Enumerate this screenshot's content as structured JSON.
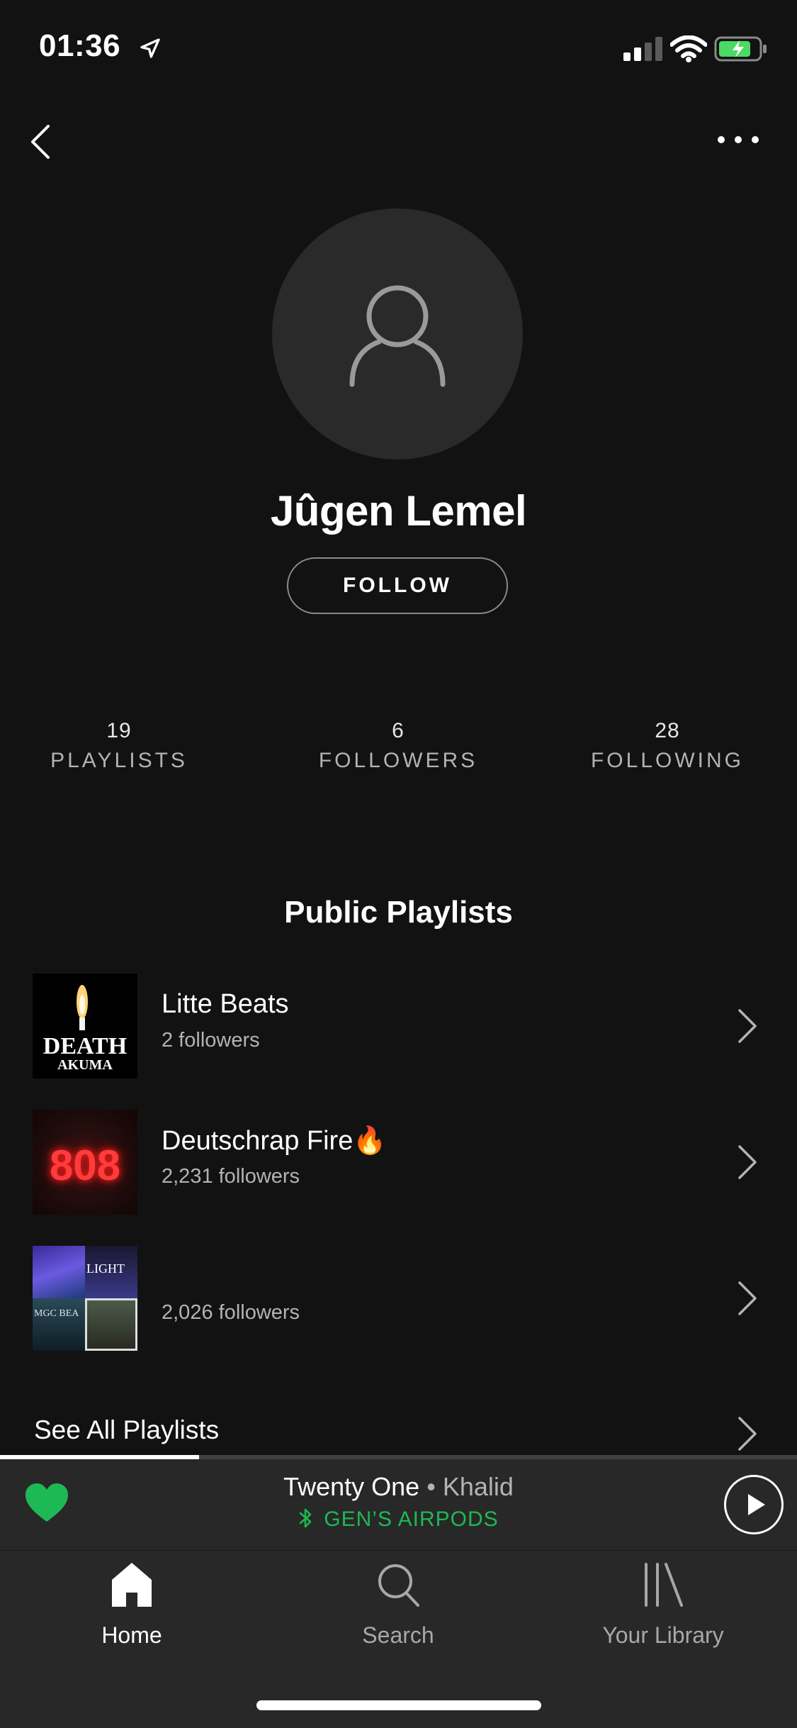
{
  "status_bar": {
    "time": "01:36"
  },
  "profile": {
    "name": "Jûgen Lemel",
    "follow_label": "FOLLOW"
  },
  "stats": [
    {
      "value": "19",
      "label": "PLAYLISTS"
    },
    {
      "value": "6",
      "label": "FOLLOWERS"
    },
    {
      "value": "28",
      "label": "FOLLOWING"
    }
  ],
  "section": {
    "title": "Public Playlists",
    "see_all_label": "See All Playlists"
  },
  "playlists": [
    {
      "title": "Litte Beats",
      "followers": "2 followers",
      "art_text_1": "DEATH",
      "art_text_2": "AKUMA"
    },
    {
      "title": "Deutschrap Fire🔥",
      "followers": "2,231 followers",
      "art_text_1": "808"
    },
    {
      "title": "",
      "followers": "2,026 followers",
      "art_text_1": "LIGHT",
      "art_text_2": "MGC BEA"
    }
  ],
  "now_playing": {
    "track": "Twenty One",
    "separator": " • ",
    "artist": "Khalid",
    "device": "GEN’S AIRPODS",
    "progress": 0.25,
    "liked": true
  },
  "tabs": [
    {
      "label": "Home",
      "icon": "home-icon",
      "active": true
    },
    {
      "label": "Search",
      "icon": "search-icon",
      "active": false
    },
    {
      "label": "Your Library",
      "icon": "library-icon",
      "active": false
    }
  ],
  "colors": {
    "background": "#121212",
    "accent": "#1db954",
    "secondary_text": "#b3b3b3",
    "bar": "#282828"
  }
}
